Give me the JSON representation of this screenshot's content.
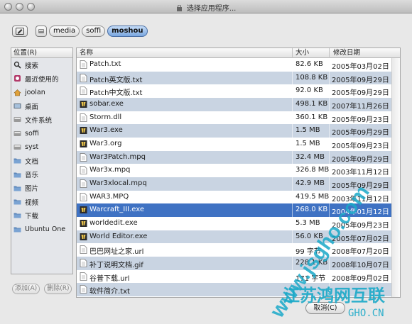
{
  "window": {
    "title": "选择应用程序..."
  },
  "path": {
    "segments": [
      "media",
      "soffi",
      "moshou"
    ],
    "active_index": 2
  },
  "sidebar": {
    "header": "位置(R)",
    "items": [
      {
        "label": "搜索",
        "icon": "search-icon"
      },
      {
        "label": "最近使用的",
        "icon": "recent-icon"
      },
      {
        "label": "joolan",
        "icon": "home-icon"
      },
      {
        "label": "桌面",
        "icon": "desktop-icon"
      },
      {
        "label": "文件系统",
        "icon": "drive-icon"
      },
      {
        "label": "soffi",
        "icon": "drive-icon"
      },
      {
        "label": "syst",
        "icon": "drive-icon"
      },
      {
        "label": "文档",
        "icon": "folder-icon"
      },
      {
        "label": "音乐",
        "icon": "folder-icon"
      },
      {
        "label": "图片",
        "icon": "folder-icon"
      },
      {
        "label": "视频",
        "icon": "folder-icon"
      },
      {
        "label": "下载",
        "icon": "folder-icon"
      },
      {
        "label": "Ubuntu One",
        "icon": "folder-icon"
      }
    ],
    "add_label": "添加(A)",
    "remove_label": "删除(R)"
  },
  "list": {
    "columns": {
      "name": "名称",
      "size": "大小",
      "date": "修改日期"
    },
    "rows": [
      {
        "name": "Patch.txt",
        "size": "82.6 KB",
        "date": "2005年03月02日",
        "icon": "text-file-icon"
      },
      {
        "name": "Patch英文版.txt",
        "size": "108.8 KB",
        "date": "2005年09月29日",
        "icon": "text-file-icon"
      },
      {
        "name": "Patch中文版.txt",
        "size": "92.0 KB",
        "date": "2005年09月29日",
        "icon": "text-file-icon"
      },
      {
        "name": "sobar.exe",
        "size": "498.1 KB",
        "date": "2007年11月26日",
        "icon": "exe-file-icon"
      },
      {
        "name": "Storm.dll",
        "size": "360.1 KB",
        "date": "2005年09月23日",
        "icon": "text-file-icon"
      },
      {
        "name": "War3.exe",
        "size": "1.5 MB",
        "date": "2005年09月29日",
        "icon": "exe-file-icon"
      },
      {
        "name": "War3.org",
        "size": "1.5 MB",
        "date": "2005年09月23日",
        "icon": "exe-file-icon"
      },
      {
        "name": "War3Patch.mpq",
        "size": "32.4 MB",
        "date": "2005年09月29日",
        "icon": "text-file-icon"
      },
      {
        "name": "War3x.mpq",
        "size": "326.8 MB",
        "date": "2003年11月12日",
        "icon": "text-file-icon"
      },
      {
        "name": "War3xlocal.mpq",
        "size": "42.9 MB",
        "date": "2005年09月29日",
        "icon": "text-file-icon"
      },
      {
        "name": "WAR3.MPQ",
        "size": "419.5 MB",
        "date": "2003年11月12日",
        "icon": "text-file-icon"
      },
      {
        "name": "Warcraft_III.exe",
        "size": "268.0 KB",
        "date": "2004年01月12日",
        "icon": "exe-file-icon",
        "selected": true
      },
      {
        "name": "worldedit.exe",
        "size": "5.3 MB",
        "date": "2005年09月23日",
        "icon": "exe-file-icon"
      },
      {
        "name": "World Editor.exe",
        "size": "56.0 KB",
        "date": "2005年07月02日",
        "icon": "exe-file-icon"
      },
      {
        "name": "巴巴网址之家.url",
        "size": "99 字节",
        "date": "2008年07月20日",
        "icon": "text-file-icon"
      },
      {
        "name": "补丁说明文档.gif",
        "size": "228.1 KB",
        "date": "2008年10月07日",
        "icon": "text-file-icon"
      },
      {
        "name": "谷普下载.url",
        "size": "171 字节",
        "date": "2008年09月02日",
        "icon": "text-file-icon"
      },
      {
        "name": "软件简介.txt",
        "size": "",
        "date": "",
        "icon": "text-file-icon"
      }
    ]
  },
  "footer": {
    "cancel_label": "取消(C)"
  },
  "watermark": {
    "text1": "www.jsgho.com",
    "text2": "江苏鸿网互联",
    "text3": "GHO.CN"
  },
  "colors": {
    "selection": "#3f72c3",
    "row_alt": "#c9d4e2",
    "accent": "#4a6fa5"
  }
}
